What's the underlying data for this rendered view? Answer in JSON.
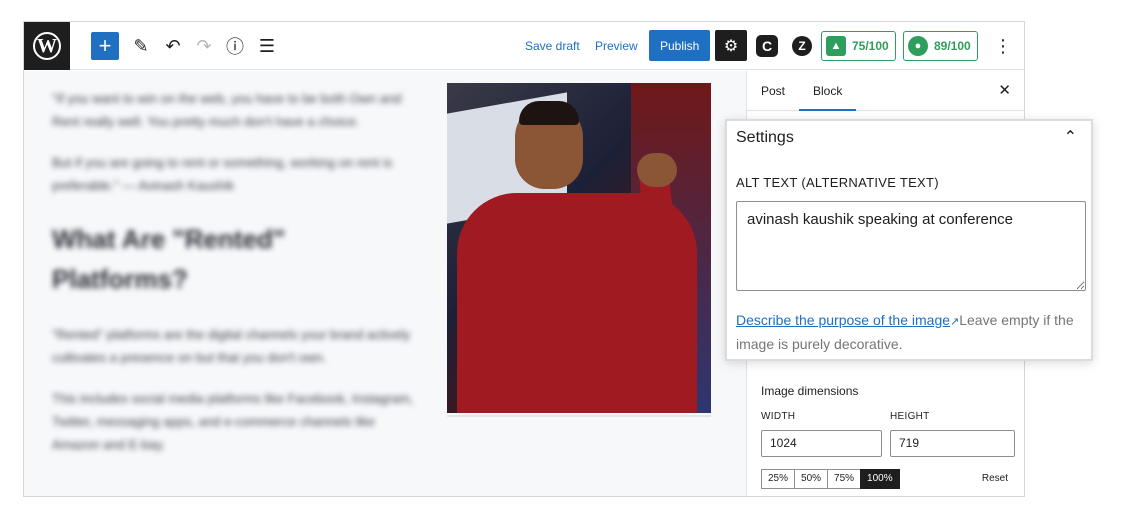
{
  "toolbar": {
    "logo": "W",
    "add_icon": "+",
    "pen_icon": "✎",
    "undo_icon": "↶",
    "redo_icon": "↷",
    "info_icon": "ⓘ",
    "list_icon": "☰",
    "save_draft": "Save draft",
    "preview": "Preview",
    "publish": "Publish",
    "settings_icon": "⚙",
    "c_icon": "C",
    "z_icon": "Z",
    "score1": "75/100",
    "score2": "89/100",
    "more_icon": "⋮"
  },
  "editor": {
    "paragraphs": [
      "\"If you want to win on the web, you have to be both Own and Rent really well. You pretty much don't have a choice.",
      "But if you are going to rent or something, working on rent is preferable.\" — Avinash Kaushik",
      "\"Rented\" platforms are the digital channels your brand actively cultivates a presence on but that you don't own.",
      "This includes social media platforms like Facebook, Instagram, Twitter, messaging apps, and e-commerce channels like Amazon and E-bay."
    ],
    "heading": "What Are \"Rented\" Platforms?"
  },
  "sidebar": {
    "tab_post": "Post",
    "tab_block": "Block",
    "close_icon": "✕",
    "dimensions_title": "Image dimensions",
    "width_label": "WIDTH",
    "height_label": "HEIGHT",
    "width_value": "1024",
    "height_value": "719",
    "pct": [
      "25%",
      "50%",
      "75%",
      "100%"
    ],
    "reset": "Reset"
  },
  "settings_panel": {
    "title": "Settings",
    "chevron_icon": "⌃",
    "alt_label": "ALT TEXT (ALTERNATIVE TEXT)",
    "alt_value": "avinash kaushik speaking at conference",
    "help_link": "Describe the purpose of the image",
    "ext_icon": "↗",
    "help_rest": "Leave empty if the image is purely decorative."
  },
  "colors": {
    "accent": "#1f6fc3",
    "score_green": "#2e9e5d",
    "dark": "#1e1e1e"
  }
}
